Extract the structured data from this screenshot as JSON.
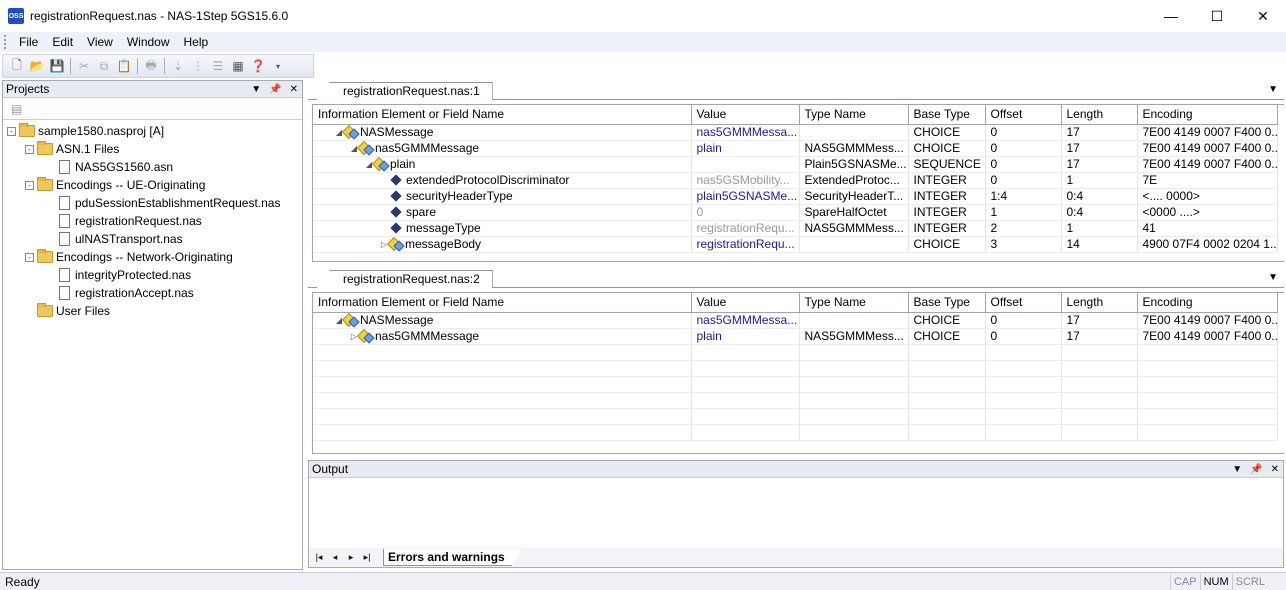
{
  "window": {
    "app_icon_text": "OSS",
    "title": "registrationRequest.nas - NAS-1Step 5GS15.6.0",
    "minimize": "—",
    "maximize": "☐",
    "close": "✕"
  },
  "menu": [
    "File",
    "Edit",
    "View",
    "Window",
    "Help"
  ],
  "projects": {
    "title": "Projects",
    "tree": [
      {
        "label": "sample1580.nasproj [A]",
        "type": "folder",
        "level": 0,
        "expander": "-"
      },
      {
        "label": "ASN.1 Files",
        "type": "folder",
        "level": 1,
        "expander": "-"
      },
      {
        "label": "NAS5GS1560.asn",
        "type": "file",
        "level": 2
      },
      {
        "label": "Encodings -- UE-Originating",
        "type": "folder",
        "level": 1,
        "expander": "-"
      },
      {
        "label": "pduSessionEstablishmentRequest.nas",
        "type": "file",
        "level": 2
      },
      {
        "label": "registrationRequest.nas",
        "type": "file",
        "level": 2
      },
      {
        "label": "ulNASTransport.nas",
        "type": "file",
        "level": 2
      },
      {
        "label": "Encodings -- Network-Originating",
        "type": "folder",
        "level": 1,
        "expander": "-"
      },
      {
        "label": "integrityProtected.nas",
        "type": "file",
        "level": 2
      },
      {
        "label": "registrationAccept.nas",
        "type": "file",
        "level": 2
      },
      {
        "label": "User Files",
        "type": "folder",
        "level": 1
      }
    ]
  },
  "columns": [
    "Information Element or Field Name",
    "Value",
    "Type Name",
    "Base Type",
    "Offset",
    "Length",
    "Encoding"
  ],
  "doc1": {
    "tab": "registrationRequest.nas:1",
    "rows": [
      {
        "name": "NASMessage",
        "level": 0,
        "tri": "◢",
        "icon": "ie",
        "value": "nas5GMMMessa...",
        "vstyle": "blue",
        "type": "",
        "base": "CHOICE",
        "offset": "0",
        "length": "17",
        "encoding": "7E00 4149 0007 F400 0..."
      },
      {
        "name": "nas5GMMMessage",
        "level": 1,
        "tri": "◢",
        "icon": "ie",
        "value": "plain",
        "vstyle": "blue",
        "type": "NAS5GMMMess...",
        "base": "CHOICE",
        "offset": "0",
        "length": "17",
        "encoding": "7E00 4149 0007 F400 0..."
      },
      {
        "name": "plain",
        "level": 2,
        "tri": "◢",
        "icon": "ie",
        "value": "",
        "vstyle": "",
        "type": "Plain5GSNASMe...",
        "base": "SEQUENCE",
        "offset": "0",
        "length": "17",
        "encoding": "7E00 4149 0007 F400 0..."
      },
      {
        "name": "extendedProtocolDiscriminator",
        "level": 3,
        "tri": "",
        "icon": "field",
        "value": "nas5GSMobility...",
        "vstyle": "gray",
        "type": "ExtendedProtoc...",
        "base": "INTEGER",
        "offset": "0",
        "length": "1",
        "encoding": "7E"
      },
      {
        "name": "securityHeaderType",
        "level": 3,
        "tri": "",
        "icon": "field",
        "value": "plain5GSNASMe...",
        "vstyle": "blue",
        "type": "SecurityHeaderT...",
        "base": "INTEGER",
        "offset": "1:4",
        "length": "0:4",
        "encoding": "<.... 0000>"
      },
      {
        "name": "spare",
        "level": 3,
        "tri": "",
        "icon": "field",
        "value": "0",
        "vstyle": "gray",
        "type": "SpareHalfOctet",
        "base": "INTEGER",
        "offset": "1",
        "length": "0:4",
        "encoding": "<0000 ....>"
      },
      {
        "name": "messageType",
        "level": 3,
        "tri": "",
        "icon": "field",
        "value": "registrationRequ...",
        "vstyle": "gray",
        "type": "NAS5GMMMess...",
        "base": "INTEGER",
        "offset": "2",
        "length": "1",
        "encoding": "41"
      },
      {
        "name": "messageBody",
        "level": 3,
        "tri": "▷",
        "icon": "ie",
        "value": "registrationRequ...",
        "vstyle": "blue",
        "type": "",
        "base": "CHOICE",
        "offset": "3",
        "length": "14",
        "encoding": "4900 07F4 0002 0204 1..."
      }
    ]
  },
  "doc2": {
    "tab": "registrationRequest.nas:2",
    "rows": [
      {
        "name": "NASMessage",
        "level": 0,
        "tri": "◢",
        "icon": "ie",
        "value": "nas5GMMMessa...",
        "vstyle": "blue",
        "type": "",
        "base": "CHOICE",
        "offset": "0",
        "length": "17",
        "encoding": "7E00 4149 0007 F400 0..."
      },
      {
        "name": "nas5GMMMessage",
        "level": 1,
        "tri": "▷",
        "icon": "ie",
        "value": "plain",
        "vstyle": "blue",
        "type": "NAS5GMMMess...",
        "base": "CHOICE",
        "offset": "0",
        "length": "17",
        "encoding": "7E00 4149 0007 F400 0..."
      }
    ]
  },
  "output": {
    "title": "Output",
    "tab": "Errors and warnings"
  },
  "status": {
    "text": "Ready",
    "caps": "CAP",
    "num": "NUM",
    "scrl": "SCRL"
  }
}
